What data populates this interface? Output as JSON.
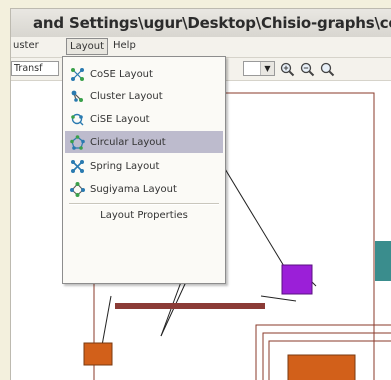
{
  "window": {
    "title": "and Settings\\ugur\\Desktop\\Chisio-graphs\\com"
  },
  "menubar": {
    "items": [
      {
        "label": "uster"
      },
      {
        "label": "Layout"
      },
      {
        "label": "Help"
      }
    ]
  },
  "toolbar": {
    "combo_value": "Transf",
    "icons": [
      "dropdown-arrow-icon",
      "zoom-in-icon",
      "zoom-out-icon",
      "zoom-fit-icon"
    ]
  },
  "layout_menu": {
    "items": [
      {
        "label": "CoSE Layout",
        "icon": "cose-layout-icon",
        "highlighted": false
      },
      {
        "label": "Cluster Layout",
        "icon": "cluster-layout-icon",
        "highlighted": false
      },
      {
        "label": "CiSE Layout",
        "icon": "cise-layout-icon",
        "highlighted": false
      },
      {
        "label": "Circular Layout",
        "icon": "circular-layout-icon",
        "highlighted": true
      },
      {
        "label": "Spring Layout",
        "icon": "spring-layout-icon",
        "highlighted": false
      },
      {
        "label": "Sugiyama Layout",
        "icon": "sugiyama-layout-icon",
        "highlighted": false
      }
    ],
    "properties_label": "Layout Properties"
  },
  "graph_colors": {
    "node_purple": "#9b1fd8",
    "node_orange": "#d2601a",
    "node_teal": "#3a8d8d",
    "edge": "#222222",
    "compound_border": "#8a3a2a",
    "bar": "#8b3b36"
  }
}
